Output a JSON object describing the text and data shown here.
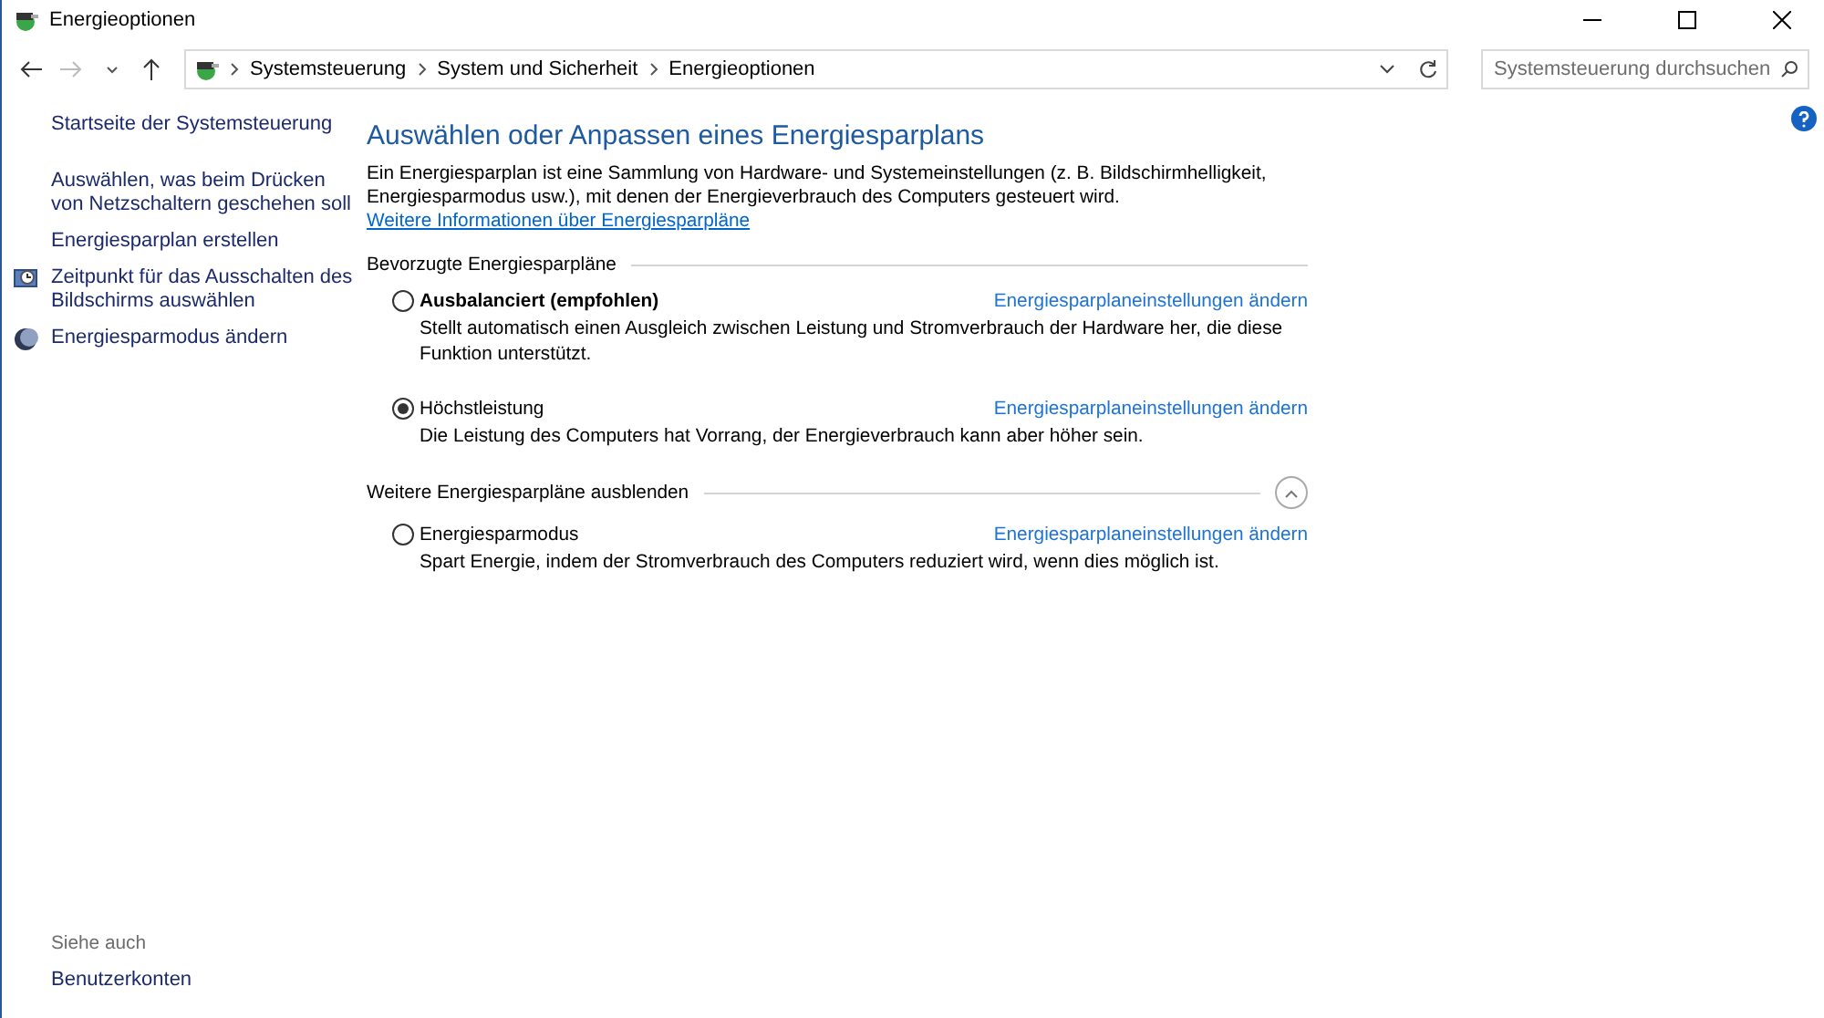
{
  "window": {
    "title": "Energieoptionen"
  },
  "breadcrumb": [
    "Systemsteuerung",
    "System und Sicherheit",
    "Energieoptionen"
  ],
  "search": {
    "placeholder": "Systemsteuerung durchsuchen"
  },
  "sidebar": {
    "items": [
      {
        "label": "Startseite der Systemsteuerung",
        "kind": "plain"
      },
      {
        "label": "Auswählen, was beim Drücken von Netzschaltern geschehen soll",
        "kind": "plain"
      },
      {
        "label": "Energiesparplan erstellen",
        "kind": "plain"
      },
      {
        "label": "Zeitpunkt für das Ausschalten des Bildschirms auswählen",
        "kind": "monitor"
      },
      {
        "label": "Energiesparmodus ändern",
        "kind": "moon"
      }
    ],
    "see_also": {
      "heading": "Siehe auch",
      "links": [
        "Benutzerkonten"
      ]
    }
  },
  "main": {
    "title": "Auswählen oder Anpassen eines Energiesparplans",
    "description": "Ein Energiesparplan ist eine Sammlung von Hardware- und Systemeinstellungen (z. B. Bildschirmhelligkeit, Energiesparmodus usw.), mit denen der Energieverbrauch des Computers gesteuert wird.",
    "description_link": "Weitere Informationen über Energiesparpläne",
    "groups": [
      {
        "heading": "Bevorzugte Energiesparpläne",
        "expanded": false,
        "plans": [
          {
            "name": "Ausbalanciert (empfohlen)",
            "recommended": true,
            "selected": false,
            "link": "Energiesparplaneinstellungen ändern",
            "description": "Stellt automatisch einen Ausgleich zwischen Leistung und Stromverbrauch der Hardware her, die diese Funktion unterstützt."
          },
          {
            "name": "Höchstleistung",
            "recommended": false,
            "selected": true,
            "link": "Energiesparplaneinstellungen ändern",
            "description": "Die Leistung des Computers hat Vorrang, der Energieverbrauch kann aber höher sein."
          }
        ]
      },
      {
        "heading": "Weitere Energiesparpläne ausblenden",
        "expanded": true,
        "plans": [
          {
            "name": "Energiesparmodus",
            "recommended": false,
            "selected": false,
            "link": "Energiesparplaneinstellungen ändern",
            "description": "Spart Energie, indem der Stromverbrauch des Computers reduziert wird, wenn dies möglich ist."
          }
        ]
      }
    ]
  }
}
